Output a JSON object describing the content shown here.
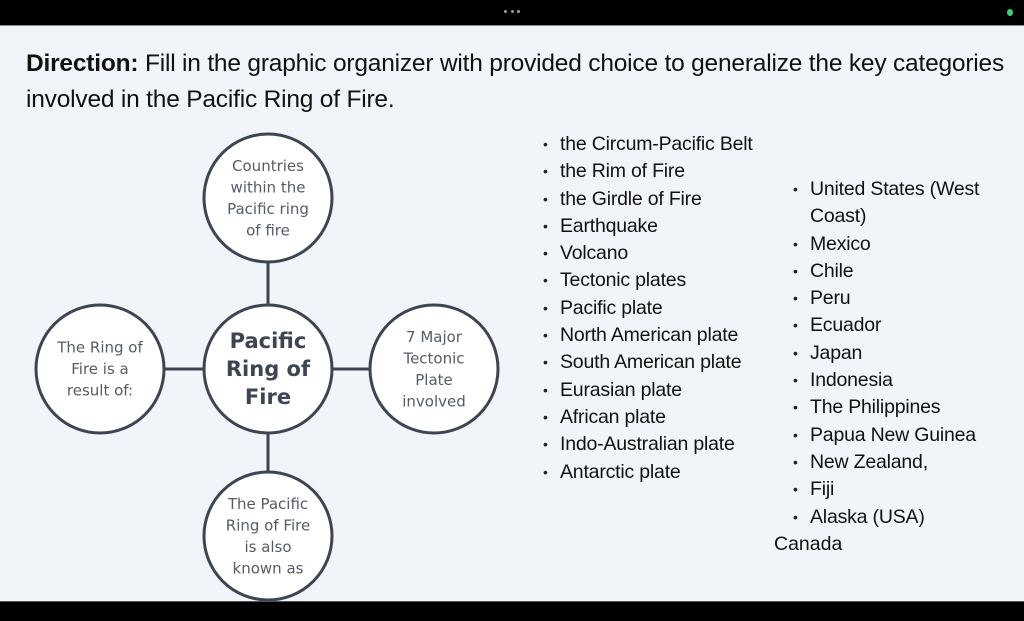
{
  "topbar": {
    "menu_icon": "more-dots-icon",
    "status_icon": "green-status-dot"
  },
  "direction": {
    "label": "Direction:",
    "text": " Fill in the graphic organizer with provided choice to generalize the key categories involved in the Pacific Ring of Fire."
  },
  "organizer": {
    "center": [
      "Pacific",
      "Ring of",
      "Fire"
    ],
    "top": [
      "Countries",
      "within the",
      "Pacific ring",
      "of fire"
    ],
    "left": [
      "The Ring of",
      "Fire is a",
      "result  of:"
    ],
    "right": [
      "7 Major",
      "Tectonic",
      "Plate",
      "involved"
    ],
    "bottom": [
      "The Pacific",
      "Ring of Fire",
      "is also",
      "known as"
    ],
    "colors": {
      "stroke": "#3d4552",
      "fill": "#ffffff"
    }
  },
  "choices_left": [
    "the Circum-Pacific Belt",
    "the Rim of Fire",
    "the Girdle of Fire",
    "Earthquake",
    "Volcano",
    "Tectonic plates",
    "Pacific plate",
    "North American plate",
    "South American plate",
    "Eurasian plate",
    "African plate",
    "Indo-Australian plate",
    "Antarctic plate"
  ],
  "choices_right": [
    "United States (West Coast)",
    "Mexico",
    "Chile",
    "Peru",
    "Ecuador",
    "Japan",
    "Indonesia",
    "The Philippines",
    "Papua New Guinea",
    "New Zealand,",
    "Fiji",
    "Alaska (USA)"
  ],
  "extra_item": "Canada",
  "bullet_char": "•"
}
